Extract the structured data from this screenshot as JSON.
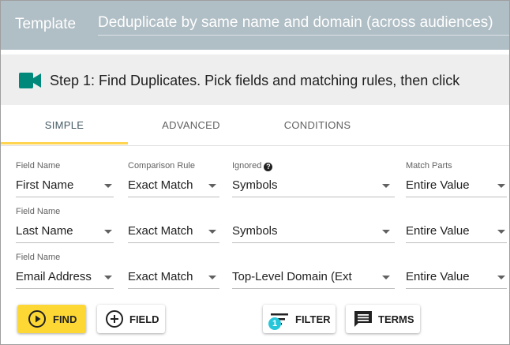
{
  "template": {
    "label": "Template",
    "value": "Deduplicate by same name and domain (across audiences)"
  },
  "step": {
    "icon": "video-camera-icon",
    "title": "Step 1: Find Duplicates. Pick fields and matching rules, then click"
  },
  "tabs": [
    {
      "label": "SIMPLE",
      "active": true
    },
    {
      "label": "ADVANCED",
      "active": false
    },
    {
      "label": "CONDITIONS",
      "active": false
    }
  ],
  "headers": {
    "field_name": "Field Name",
    "comparison_rule": "Comparison Rule",
    "ignored": "Ignored",
    "match_parts": "Match Parts"
  },
  "rows": [
    {
      "field_label": "Field Name",
      "field": "First Name",
      "rule": "Exact Match",
      "ignored": "Symbols",
      "match": "Entire Value"
    },
    {
      "field_label": "Field Name",
      "field": "Last Name",
      "rule": "Exact Match",
      "ignored": "Symbols",
      "match": "Entire Value"
    },
    {
      "field_label": "Field Name",
      "field": "Email Address",
      "rule": "Exact Match",
      "ignored": "Top-Level Domain (Ext",
      "match": "Entire Value"
    }
  ],
  "buttons": {
    "find": "FIND",
    "field": "FIELD",
    "filter": "FILTER",
    "filter_badge": "1",
    "terms": "TERMS"
  },
  "colors": {
    "template_bar": "#b0bec5",
    "accent_yellow": "#fdd835",
    "camera_icon": "#00897b",
    "badge": "#26c6da"
  }
}
